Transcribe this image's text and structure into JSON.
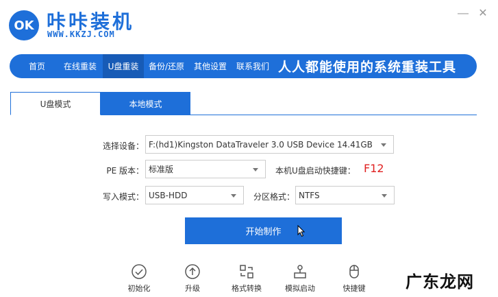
{
  "header": {
    "logo_mark": "OK",
    "title": "咔咔装机",
    "url": "WWW.KKZJ.COM",
    "min_label": "—",
    "close_label": "✕"
  },
  "nav": {
    "items": [
      {
        "label": "首页"
      },
      {
        "label": "在线重装"
      },
      {
        "label": "U盘重装",
        "active": true
      },
      {
        "label": "备份/还原"
      },
      {
        "label": "其他设置"
      },
      {
        "label": "联系我们"
      }
    ],
    "slogan": "人人都能使用的系统重装工具"
  },
  "tabs": [
    {
      "label": "U盘模式",
      "active": true
    },
    {
      "label": "本地模式",
      "active": false
    }
  ],
  "form": {
    "device_label": "选择设备：",
    "device_value": "F:(hd1)Kingston DataTraveler 3.0 USB Device 14.41GB",
    "pe_label": "PE 版本：",
    "pe_value": "标准版",
    "hotkey_label": "本机U盘启动快捷键：",
    "hotkey_value": "F12",
    "write_label": "写入模式：",
    "write_value": "USB-HDD",
    "partition_label": "分区格式：",
    "partition_value": "NTFS"
  },
  "start_button": "开始制作",
  "tools": [
    {
      "label": "初始化",
      "icon": "check-circle-icon"
    },
    {
      "label": "升级",
      "icon": "upgrade-icon"
    },
    {
      "label": "格式转换",
      "icon": "convert-icon"
    },
    {
      "label": "模拟启动",
      "icon": "simulate-boot-icon"
    },
    {
      "label": "快捷键",
      "icon": "mouse-icon"
    }
  ],
  "watermark": "广东龙网",
  "colors": {
    "accent": "#1e6fd9",
    "hotkey": "#e02020"
  }
}
